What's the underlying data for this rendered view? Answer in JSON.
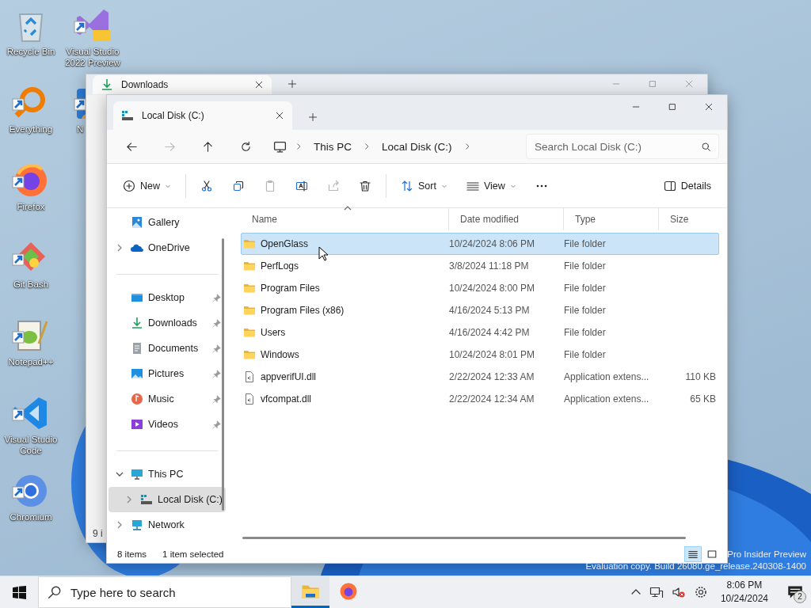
{
  "desktop_icons": [
    {
      "label": "Recycle Bin",
      "kind": "recycle"
    },
    {
      "label": "Everything",
      "kind": "everything"
    },
    {
      "label": "Firefox",
      "kind": "firefox"
    },
    {
      "label": "Git Bash",
      "kind": "git"
    },
    {
      "label": "Notepad++",
      "kind": "notepad"
    },
    {
      "label": "Visual Studio Code",
      "kind": "vscode"
    },
    {
      "label": "Chromium",
      "kind": "chromium"
    },
    {
      "label": "Visual Studio 2022 Preview",
      "kind": "vs"
    },
    {
      "label": "N",
      "kind": "person"
    }
  ],
  "background_window": {
    "tab": "Downloads",
    "status": "9 i"
  },
  "window": {
    "tab": "Local Disk (C:)",
    "breadcrumb": [
      "This PC",
      "Local Disk (C:)"
    ],
    "search": {
      "placeholder": "Search Local Disk (C:)"
    },
    "toolbar": [
      {
        "kind": "new",
        "label": "New",
        "caret": true
      },
      {
        "kind": "cut",
        "disabled": false
      },
      {
        "kind": "copy",
        "disabled": false
      },
      {
        "kind": "paste",
        "disabled": true
      },
      {
        "kind": "rename",
        "disabled": false
      },
      {
        "kind": "share",
        "disabled": true
      },
      {
        "kind": "delete",
        "disabled": false
      },
      {
        "kind": "sort",
        "label": "Sort",
        "caret": true
      },
      {
        "kind": "view",
        "label": "View",
        "caret": true
      },
      {
        "kind": "more"
      },
      {
        "kind": "details",
        "label": "Details",
        "caret": false
      }
    ],
    "nav": [
      [
        {
          "label": "Gallery",
          "kind": "gallery",
          "selected": false
        },
        {
          "label": "OneDrive",
          "kind": "onedrive",
          "expanded": false,
          "selected": false
        }
      ],
      [
        {
          "label": "Desktop",
          "kind": "desktop",
          "pinned": true,
          "selected": false
        },
        {
          "label": "Downloads",
          "kind": "downloads",
          "pinned": true,
          "selected": false
        },
        {
          "label": "Documents",
          "kind": "documents",
          "pinned": true,
          "selected": false
        },
        {
          "label": "Pictures",
          "kind": "pictures",
          "pinned": true,
          "selected": false
        },
        {
          "label": "Music",
          "kind": "music",
          "pinned": true,
          "selected": false
        },
        {
          "label": "Videos",
          "kind": "videos",
          "pinned": true,
          "selected": false
        }
      ],
      [
        {
          "label": "This PC",
          "kind": "pc",
          "expanded": true,
          "selected": false,
          "children": [
            {
              "label": "Local Disk (C:)",
              "kind": "disk",
              "expanded": false,
              "selected": true
            }
          ]
        },
        {
          "label": "Network",
          "kind": "network",
          "expanded": false,
          "selected": false
        }
      ]
    ],
    "columns": [
      {
        "label": "Name",
        "sorted": true
      },
      {
        "label": "Date modified",
        "sorted": false
      },
      {
        "label": "Type",
        "sorted": false
      },
      {
        "label": "Size",
        "sorted": false
      }
    ],
    "files": [
      {
        "name": "OpenGlass",
        "date": "10/24/2024 8:06 PM",
        "type": "File folder",
        "kind": "folder",
        "selected": true
      },
      {
        "name": "PerfLogs",
        "date": "3/8/2024 11:18 PM",
        "type": "File folder",
        "kind": "folder",
        "selected": false
      },
      {
        "name": "Program Files",
        "date": "10/24/2024 8:00 PM",
        "type": "File folder",
        "kind": "folder",
        "selected": false
      },
      {
        "name": "Program Files (x86)",
        "date": "4/16/2024 5:13 PM",
        "type": "File folder",
        "kind": "folder",
        "selected": false
      },
      {
        "name": "Users",
        "date": "4/16/2024 4:42 PM",
        "type": "File folder",
        "kind": "folder",
        "selected": false
      },
      {
        "name": "Windows",
        "date": "10/24/2024 8:01 PM",
        "type": "File folder",
        "kind": "folder",
        "selected": false
      },
      {
        "name": "appverifUI.dll",
        "date": "2/22/2024 12:33 AM",
        "type": "Application extens...",
        "size": "110 KB",
        "kind": "file",
        "selected": false
      },
      {
        "name": "vfcompat.dll",
        "date": "2/22/2024 12:34 AM",
        "type": "Application extens...",
        "size": "65 KB",
        "kind": "file",
        "selected": false
      }
    ],
    "status": {
      "count": "8 items",
      "selection": "1 item selected"
    },
    "view_buttons": [
      {
        "kind": "details",
        "selected": true
      },
      {
        "kind": "tiles",
        "selected": false
      }
    ]
  },
  "watermark": [
    "Pro Insider Preview",
    "Evaluation copy. Build 26080.ge_release.240308-1400"
  ],
  "taskbar": {
    "search": {
      "placeholder": "Type here to search"
    },
    "apps": [
      {
        "kind": "explorer",
        "active": true
      },
      {
        "kind": "firefox",
        "active": false
      }
    ],
    "volume": {
      "muted": true
    },
    "time": "8:06 PM",
    "date": "10/24/2024",
    "notifications": "2"
  }
}
